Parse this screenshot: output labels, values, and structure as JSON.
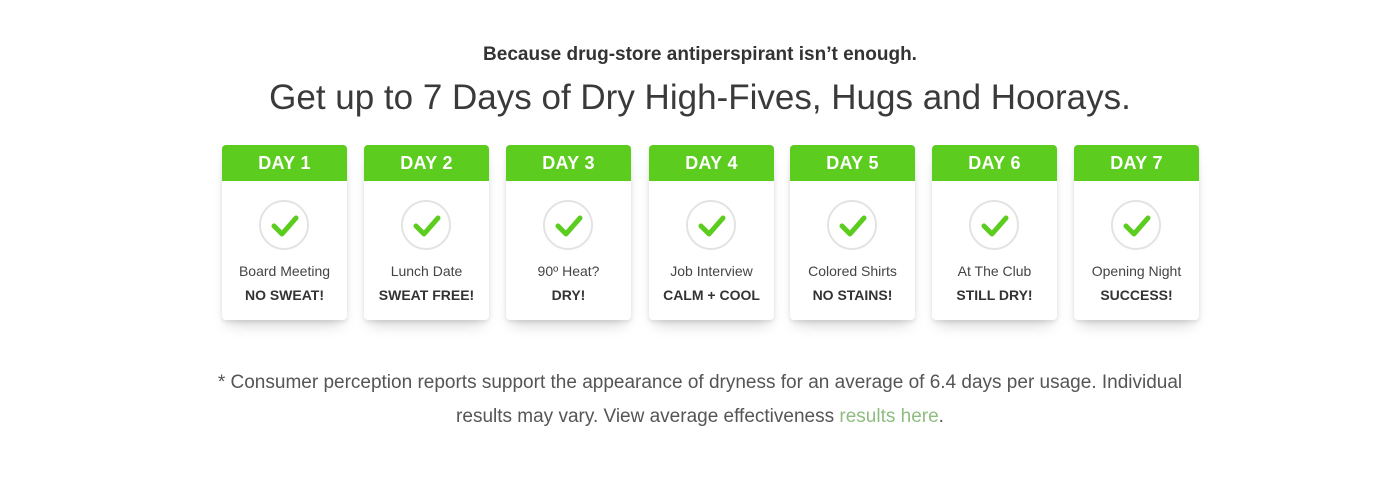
{
  "header": {
    "subheadline": "Because drug-store antiperspirant isn’t enough.",
    "headline": "Get up to 7 Days of Dry High-Fives, Hugs and Hoorays."
  },
  "cards": [
    {
      "day": "DAY 1",
      "label": "Board Meeting",
      "result": "NO SWEAT!"
    },
    {
      "day": "DAY 2",
      "label": "Lunch Date",
      "result": "SWEAT FREE!"
    },
    {
      "day": "DAY 3",
      "label": "90º Heat?",
      "result": "DRY!"
    },
    {
      "day": "DAY 4",
      "label": "Job Interview",
      "result": "CALM + COOL"
    },
    {
      "day": "DAY 5",
      "label": "Colored Shirts",
      "result": "NO STAINS!"
    },
    {
      "day": "DAY 6",
      "label": "At The Club",
      "result": "STILL DRY!"
    },
    {
      "day": "DAY 7",
      "label": "Opening Night",
      "result": "SUCCESS!"
    }
  ],
  "icons": {
    "card_icon": "checkmark-icon"
  },
  "colors": {
    "accent_green": "#5ccc1f",
    "link_green": "#8fbd7f",
    "text_dark": "#333333"
  },
  "disclaimer": {
    "text_before_link": "* Consumer perception reports support the appearance of dryness for an average of 6.4 days per usage. Individual results may vary. View average effectiveness ",
    "link_text": "results here",
    "text_after_link": "."
  }
}
